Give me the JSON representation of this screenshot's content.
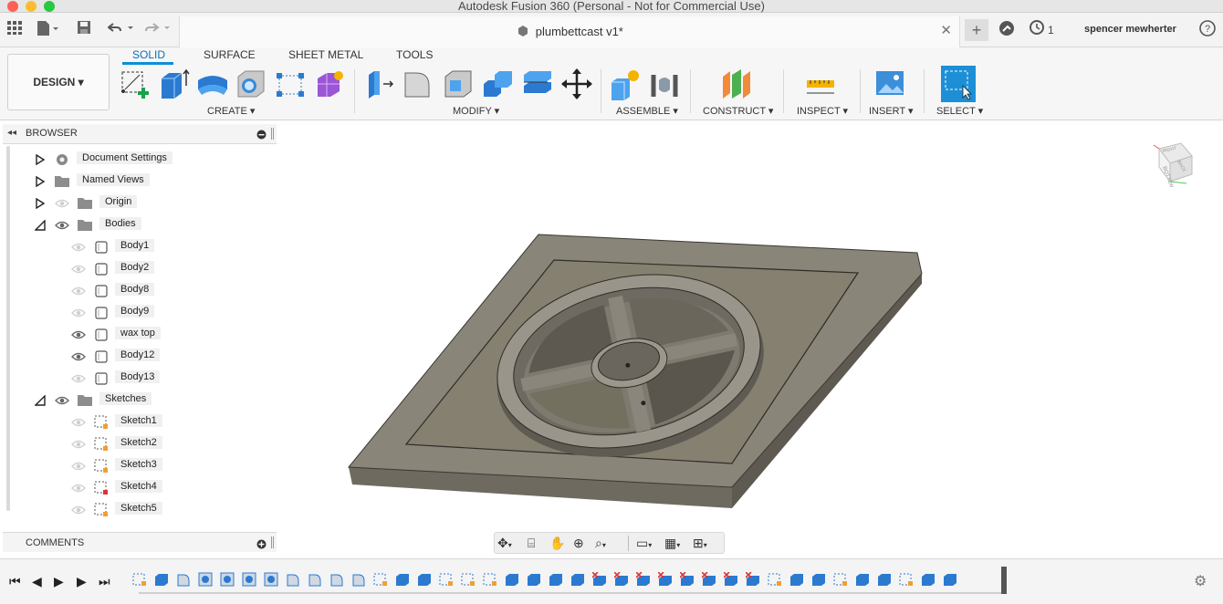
{
  "window": {
    "title": "Autodesk Fusion 360 (Personal - Not for Commercial Use)"
  },
  "appbar": {
    "document_title": "plumbettcast v1*",
    "job_count": "1",
    "user_name": "spencer mewherter",
    "icons": [
      "grid-menu-icon",
      "file-icon",
      "save-icon",
      "undo-icon",
      "redo-icon",
      "close-icon",
      "new-tab-icon",
      "extensions-icon",
      "job-status-icon",
      "help-icon"
    ]
  },
  "ribbon": {
    "workspace_label": "DESIGN ▾",
    "tabs": [
      {
        "label": "SOLID",
        "active": true
      },
      {
        "label": "SURFACE",
        "active": false
      },
      {
        "label": "SHEET METAL",
        "active": false
      },
      {
        "label": "TOOLS",
        "active": false
      }
    ],
    "groups": [
      {
        "label": "CREATE ▾"
      },
      {
        "label": "MODIFY ▾"
      },
      {
        "label": "ASSEMBLE ▾"
      },
      {
        "label": "CONSTRUCT ▾"
      },
      {
        "label": "INSPECT ▾"
      },
      {
        "label": "INSERT ▾"
      },
      {
        "label": "SELECT ▾"
      }
    ]
  },
  "browser": {
    "title": "BROWSER",
    "items": [
      {
        "label": "Document Settings",
        "type": "settings"
      },
      {
        "label": "Named Views",
        "type": "folder"
      },
      {
        "label": "Origin",
        "type": "folder"
      },
      {
        "label": "Bodies",
        "type": "folder"
      },
      {
        "label": "Body1",
        "type": "body"
      },
      {
        "label": "Body2",
        "type": "body"
      },
      {
        "label": "Body8",
        "type": "body"
      },
      {
        "label": "Body9",
        "type": "body"
      },
      {
        "label": "wax top",
        "type": "body"
      },
      {
        "label": "Body12",
        "type": "body"
      },
      {
        "label": "Body13",
        "type": "body"
      },
      {
        "label": "Sketches",
        "type": "folder"
      },
      {
        "label": "Sketch1",
        "type": "sketch"
      },
      {
        "label": "Sketch2",
        "type": "sketch"
      },
      {
        "label": "Sketch3",
        "type": "sketch"
      },
      {
        "label": "Sketch4",
        "type": "sketch"
      },
      {
        "label": "Sketch5",
        "type": "sketch"
      }
    ]
  },
  "comments": {
    "title": "COMMENTS"
  },
  "viewcube": {
    "faces": [
      "RIGHT",
      "BOTTOM",
      "BACK"
    ]
  },
  "colors": {
    "accent": "#0a8fd8",
    "model_top": "#8a8579",
    "model_side": "#6e695f",
    "select_blue": "#1d8fd6"
  }
}
